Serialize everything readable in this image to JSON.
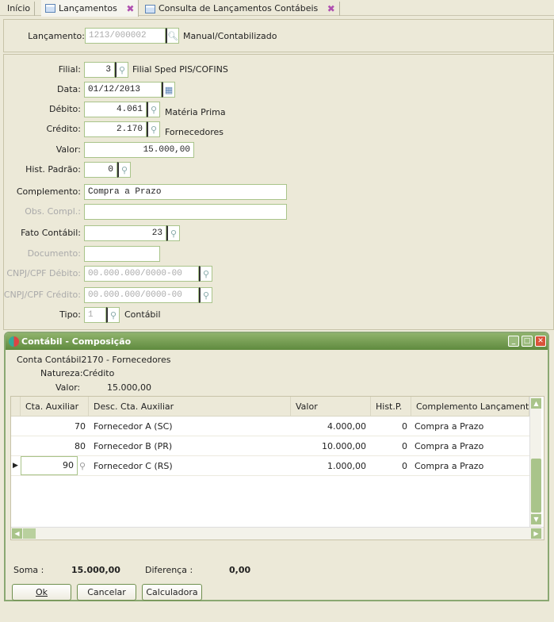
{
  "tabs": [
    {
      "label": "Início"
    },
    {
      "label": "Lançamentos"
    },
    {
      "label": "Consulta de Lançamentos Contábeis"
    }
  ],
  "header": {
    "lancamento_label": "Lançamento:",
    "lancamento_value": "1213/000002",
    "status": "Manual/Contabilizado"
  },
  "form": {
    "filial": {
      "label": "Filial:",
      "value": "3",
      "desc": "Filial Sped PIS/COFINS"
    },
    "data": {
      "label": "Data:",
      "value": "01/12/2013"
    },
    "debito": {
      "label": "Débito:",
      "value": "4.061",
      "desc": "Matéria Prima"
    },
    "credito": {
      "label": "Crédito:",
      "value": "2.170",
      "desc": "Fornecedores"
    },
    "valor": {
      "label": "Valor:",
      "value": "15.000,00"
    },
    "hist": {
      "label": "Hist. Padrão:",
      "value": "0"
    },
    "complemento": {
      "label": "Complemento:",
      "value": "Compra a Prazo"
    },
    "obs": {
      "label": "Obs. Compl.:",
      "value": ""
    },
    "fato": {
      "label": "Fato Contábil:",
      "value": "23"
    },
    "documento": {
      "label": "Documento:",
      "value": ""
    },
    "cnpj_deb": {
      "label": "CNPJ/CPF Débito:",
      "value": "00.000.000/0000-00"
    },
    "cnpj_cred": {
      "label": "CNPJ/CPF Crédito:",
      "value": "00.000.000/0000-00"
    },
    "tipo": {
      "label": "Tipo:",
      "value": "1",
      "desc": "Contábil"
    }
  },
  "dialog": {
    "title": "Contábil - Composição",
    "conta": "Conta Contábil2170 - Fornecedores",
    "natureza": "Natureza:Crédito",
    "valor_label": "Valor:",
    "valor": "15.000,00",
    "columns": [
      "Cta. Auxiliar",
      "Desc. Cta. Auxiliar",
      "Valor",
      "Hist.P.",
      "Complemento Lançamento"
    ],
    "rows": [
      {
        "cta": "70",
        "desc": "Fornecedor A (SC)",
        "valor": "4.000,00",
        "hist": "0",
        "compl": "Compra a Prazo"
      },
      {
        "cta": "80",
        "desc": "Fornecedor B (PR)",
        "valor": "10.000,00",
        "hist": "0",
        "compl": "Compra a Prazo"
      },
      {
        "cta": "90",
        "desc": "Fornecedor C (RS)",
        "valor": "1.000,00",
        "hist": "0",
        "compl": "Compra a Prazo"
      }
    ],
    "soma_label": "Soma :",
    "soma": "15.000,00",
    "dif_label": "Diferença :",
    "dif": "0,00",
    "buttons": {
      "ok": "Ok",
      "cancelar": "Cancelar",
      "calc": "Calculadora"
    }
  }
}
